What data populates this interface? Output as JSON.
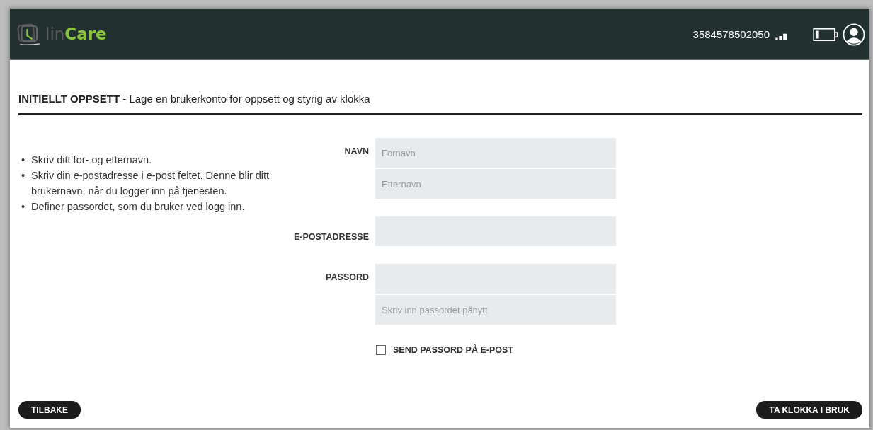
{
  "header": {
    "logo": {
      "text_1": "lin",
      "text_2": "Care"
    },
    "phone_number": "3584578502050"
  },
  "title": {
    "bold": "INITIELLT OPPSETT",
    "rest": " - Lage en brukerkonto for oppsett og styrig av klokka"
  },
  "instructions": [
    {
      "bullet": "•",
      "text": "Skriv ditt for- og etternavn."
    },
    {
      "bullet": "•",
      "text": "Skriv din e-postadresse i e-post feltet. Denne blir ditt brukernavn, når du logger inn på tjenesten."
    },
    {
      "bullet": "•",
      "text": "Definer passordet, som du bruker ved logg inn."
    }
  ],
  "form": [
    {
      "label": "NAVN",
      "fields": [
        {
          "kind": "input",
          "placeholder": "Fornavn"
        },
        {
          "kind": "input",
          "placeholder": "Etternavn"
        }
      ]
    },
    {
      "label": "E-POSTADRESSE",
      "fields": [
        {
          "kind": "input"
        }
      ]
    },
    {
      "label": "PASSORD",
      "fields": [
        {
          "kind": "input"
        },
        {
          "kind": "input",
          "placeholder": "Skriv inn passordet pånytt"
        }
      ]
    }
  ],
  "send_password_checkbox": {
    "label": "SEND PASSORD PÅ E-POST",
    "checked": false
  },
  "buttons": [
    {
      "label": "TILBAKE"
    },
    {
      "label": "TA KLOKKA I BRUK"
    }
  ]
}
